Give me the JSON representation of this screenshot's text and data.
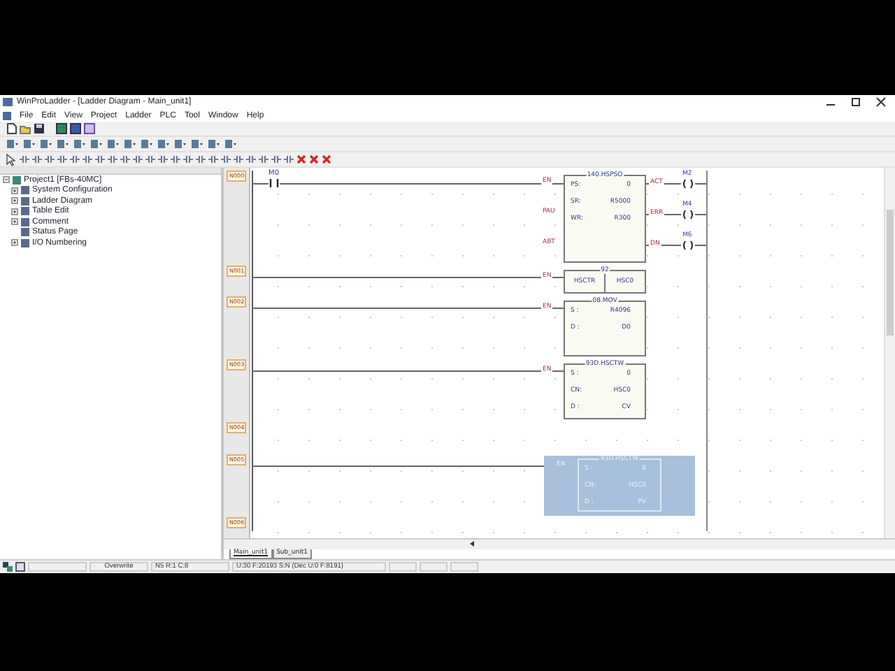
{
  "window": {
    "title": "WinProLadder - [Ladder Diagram - Main_unit1]"
  },
  "menu": [
    "File",
    "Edit",
    "View",
    "Project",
    "Ladder",
    "PLC",
    "Tool",
    "Window",
    "Help"
  ],
  "tree": {
    "label": "Project1 [FBs-40MC]",
    "expanded": true,
    "children": [
      {
        "label": "System Configuration",
        "expanded": false
      },
      {
        "label": "Ladder Diagram",
        "expanded": false
      },
      {
        "label": "Table Edit",
        "expanded": false
      },
      {
        "label": "Comment",
        "expanded": false
      },
      {
        "label": "Status Page"
      },
      {
        "label": "I/O Numbering",
        "expanded": false
      }
    ]
  },
  "networks": [
    "N000",
    "N001",
    "N002",
    "N003",
    "N004",
    "N005",
    "N006"
  ],
  "contact": {
    "label": "M0"
  },
  "blocks": [
    {
      "kind": "box",
      "title": "140.HSPSO",
      "inputs": [
        "EN",
        "PAU",
        "ABT"
      ],
      "rows": [
        {
          "label": "PS:",
          "value": "0"
        },
        {
          "label": "SR:",
          "value": "R5000"
        },
        {
          "label": "WR:",
          "value": "R300"
        }
      ],
      "outputs": [
        {
          "pin": "ACT",
          "coil": "M2"
        },
        {
          "pin": "ERR",
          "coil": "M4"
        },
        {
          "pin": "DN",
          "coil": "M6"
        }
      ],
      "selected": false
    },
    {
      "kind": "split",
      "title": "92",
      "inputs": [
        "EN"
      ],
      "cells": [
        "HSCTR",
        "HSC0"
      ],
      "selected": false
    },
    {
      "kind": "box",
      "title": "08.MOV",
      "inputs": [
        "EN"
      ],
      "rows": [
        {
          "label": "S :",
          "value": "R4096"
        },
        {
          "label": "D :",
          "value": "D0"
        }
      ],
      "selected": false
    },
    {
      "kind": "box",
      "title": "93D.HSCTW",
      "inputs": [
        "EN"
      ],
      "rows": [
        {
          "label": "S :",
          "value": "0"
        },
        {
          "label": "CN:",
          "value": "HSC0"
        },
        {
          "label": "D :",
          "value": "CV"
        }
      ],
      "selected": false
    },
    {
      "kind": "box",
      "title": "93D.HSCTW",
      "inputs": [
        "EN"
      ],
      "rows": [
        {
          "label": "S :",
          "value": "0"
        },
        {
          "label": "CN:",
          "value": "HSC0"
        },
        {
          "label": "D :",
          "value": "PV"
        }
      ],
      "selected": true
    }
  ],
  "tabs": [
    {
      "label": "Main_unit1",
      "selected": true
    },
    {
      "label": "Sub_unit1",
      "selected": false
    }
  ],
  "status_bar": {
    "mode": "Overwrite",
    "position": "N5 R:1 C:8",
    "usage": "U:30 F:20193 S:N (Dec U:0 F:8191)"
  }
}
